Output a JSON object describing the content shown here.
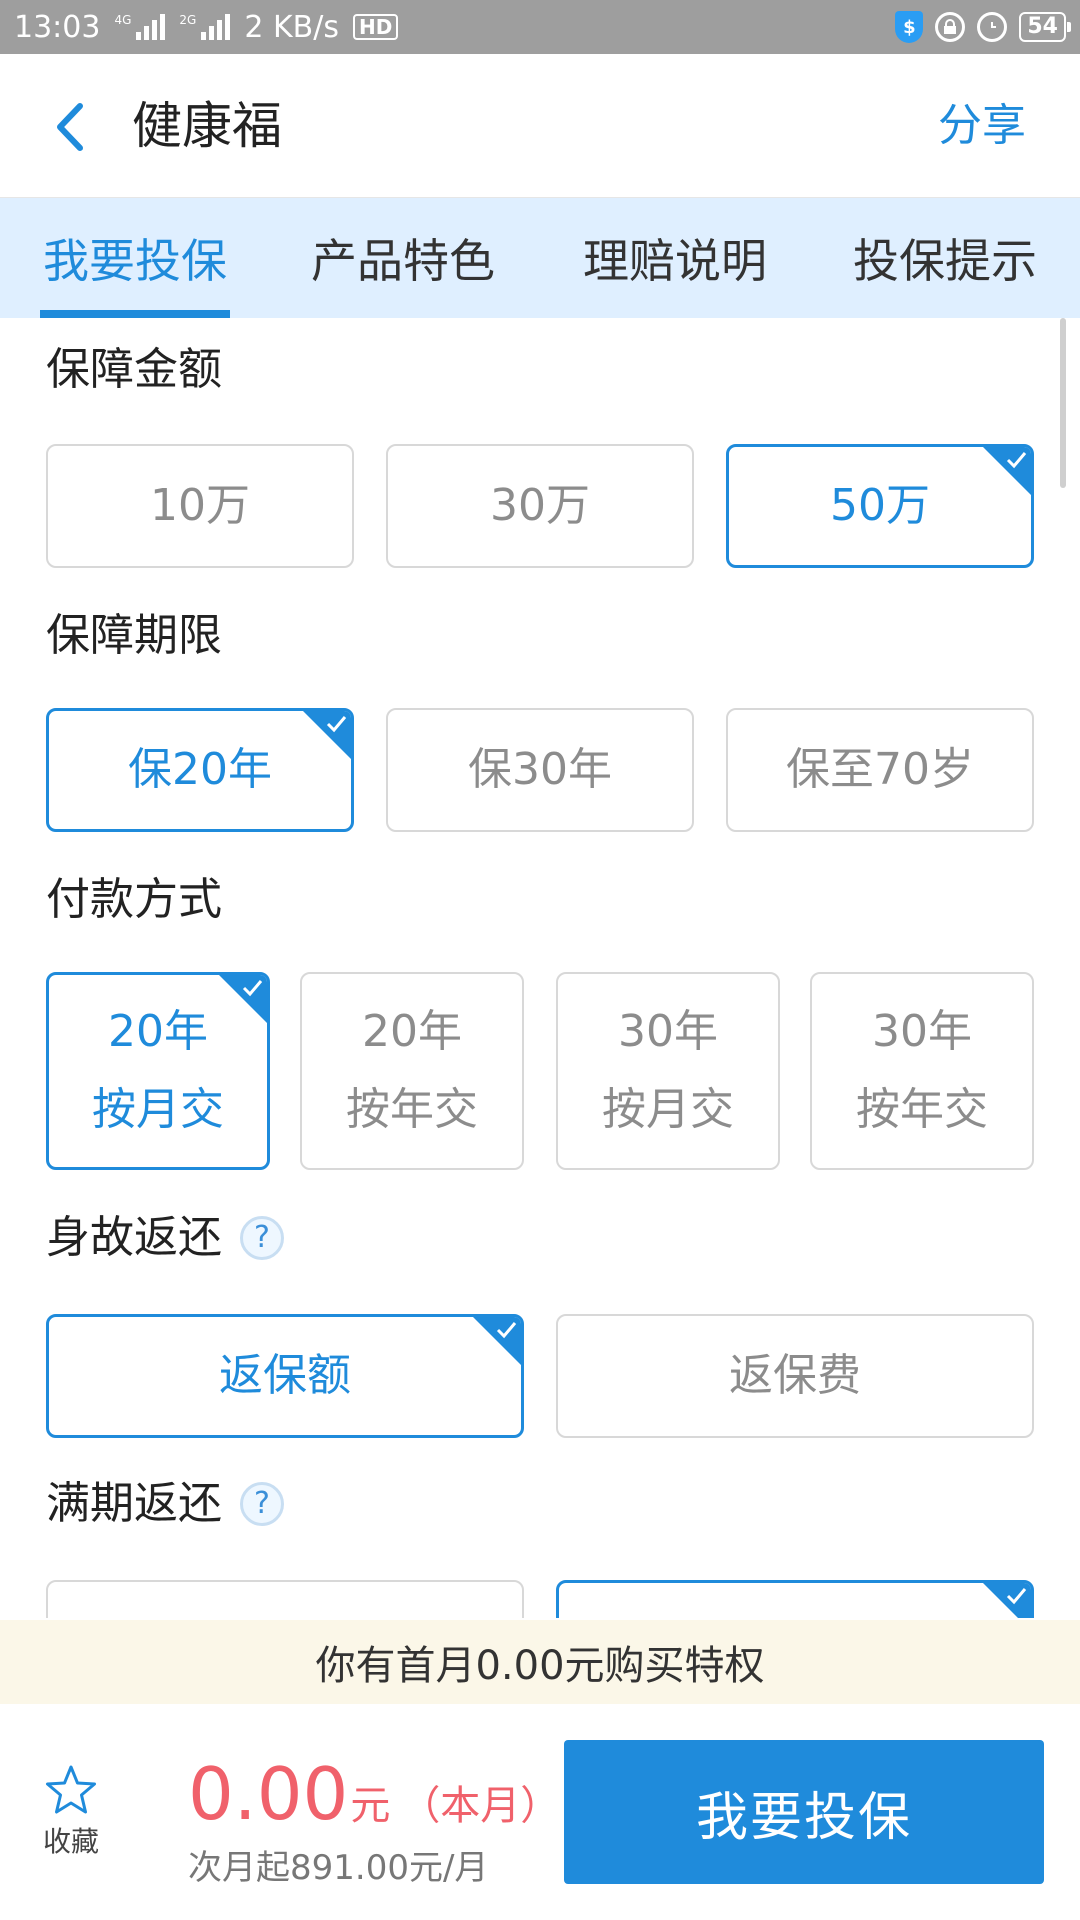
{
  "status_bar": {
    "time": "13:03",
    "net1": "4G",
    "net2": "2G",
    "speed": "2 KB/s",
    "hd": "HD",
    "battery": "54"
  },
  "header": {
    "title": "健康福",
    "share": "分享"
  },
  "tabs": [
    {
      "label": "我要投保",
      "active": true
    },
    {
      "label": "产品特色",
      "active": false
    },
    {
      "label": "理赔说明",
      "active": false
    },
    {
      "label": "投保提示",
      "active": false
    }
  ],
  "sections": {
    "coverage": {
      "title": "保障金额",
      "options": [
        "10万",
        "30万",
        "50万"
      ],
      "selected": "50万"
    },
    "term": {
      "title": "保障期限",
      "options": [
        "保20年",
        "保30年",
        "保至70岁"
      ],
      "selected": "保20年"
    },
    "payment": {
      "title": "付款方式",
      "options": [
        {
          "line1": "20年",
          "line2": "按月交"
        },
        {
          "line1": "20年",
          "line2": "按年交"
        },
        {
          "line1": "30年",
          "line2": "按月交"
        },
        {
          "line1": "30年",
          "line2": "按年交"
        }
      ],
      "selected_index": 0
    },
    "death_return": {
      "title": "身故返还",
      "help": "?",
      "options": [
        "返保额",
        "返保费"
      ],
      "selected": "返保额"
    },
    "maturity_return": {
      "title": "满期返还",
      "help": "?",
      "selected_index": 1
    }
  },
  "promo": {
    "text": "你有首月0.00元购买特权"
  },
  "bottom": {
    "favorite_label": "收藏",
    "price": "0.00",
    "price_unit": "元",
    "price_note": "（本月）",
    "price_sub": "次月起891.00元/月",
    "buy_label": "我要投保"
  },
  "colors": {
    "accent": "#1f8bdb",
    "price": "#f0616b",
    "tab_bg": "#dfefff",
    "promo_bg": "#fbf7e8",
    "status_bg": "#9e9e9e"
  }
}
